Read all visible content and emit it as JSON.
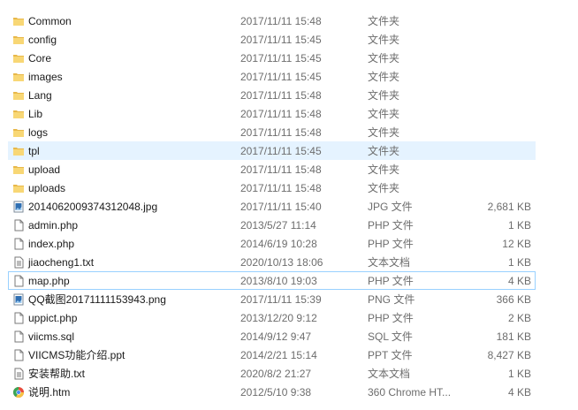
{
  "files": [
    {
      "name": "Common",
      "date": "2017/11/11 15:48",
      "type": "文件夹",
      "size": "",
      "icon": "folder-icon",
      "state": ""
    },
    {
      "name": "config",
      "date": "2017/11/11 15:45",
      "type": "文件夹",
      "size": "",
      "icon": "folder-icon",
      "state": ""
    },
    {
      "name": "Core",
      "date": "2017/11/11 15:45",
      "type": "文件夹",
      "size": "",
      "icon": "folder-icon",
      "state": ""
    },
    {
      "name": "images",
      "date": "2017/11/11 15:45",
      "type": "文件夹",
      "size": "",
      "icon": "folder-icon",
      "state": ""
    },
    {
      "name": "Lang",
      "date": "2017/11/11 15:48",
      "type": "文件夹",
      "size": "",
      "icon": "folder-icon",
      "state": ""
    },
    {
      "name": "Lib",
      "date": "2017/11/11 15:48",
      "type": "文件夹",
      "size": "",
      "icon": "folder-icon",
      "state": ""
    },
    {
      "name": "logs",
      "date": "2017/11/11 15:48",
      "type": "文件夹",
      "size": "",
      "icon": "folder-icon",
      "state": ""
    },
    {
      "name": "tpl",
      "date": "2017/11/11 15:45",
      "type": "文件夹",
      "size": "",
      "icon": "folder-icon",
      "state": "hover"
    },
    {
      "name": "upload",
      "date": "2017/11/11 15:48",
      "type": "文件夹",
      "size": "",
      "icon": "folder-icon",
      "state": ""
    },
    {
      "name": "uploads",
      "date": "2017/11/11 15:48",
      "type": "文件夹",
      "size": "",
      "icon": "folder-icon",
      "state": ""
    },
    {
      "name": "20140620093743120​48.jpg",
      "date": "2017/11/11 15:40",
      "type": "JPG 文件",
      "size": "2,681 KB",
      "icon": "image-file-icon",
      "state": ""
    },
    {
      "name": "admin.php",
      "date": "2013/5/27 11:14",
      "type": "PHP 文件",
      "size": "1 KB",
      "icon": "blank-file-icon",
      "state": ""
    },
    {
      "name": "index.php",
      "date": "2014/6/19 10:28",
      "type": "PHP 文件",
      "size": "12 KB",
      "icon": "blank-file-icon",
      "state": ""
    },
    {
      "name": "jiaocheng1.txt",
      "date": "2020/10/13 18:06",
      "type": "文本文档",
      "size": "1 KB",
      "icon": "text-file-icon",
      "state": ""
    },
    {
      "name": "map.php",
      "date": "2013/8/10 19:03",
      "type": "PHP 文件",
      "size": "4 KB",
      "icon": "blank-file-icon",
      "state": "focused"
    },
    {
      "name": "QQ截图20171111153943.png",
      "date": "2017/11/11 15:39",
      "type": "PNG 文件",
      "size": "366 KB",
      "icon": "image-file-icon",
      "state": ""
    },
    {
      "name": "uppict.php",
      "date": "2013/12/20 9:12",
      "type": "PHP 文件",
      "size": "2 KB",
      "icon": "blank-file-icon",
      "state": ""
    },
    {
      "name": "viicms.sql",
      "date": "2014/9/12 9:47",
      "type": "SQL 文件",
      "size": "181 KB",
      "icon": "blank-file-icon",
      "state": ""
    },
    {
      "name": "VIICMS功能介绍.ppt",
      "date": "2014/2/21 15:14",
      "type": "PPT 文件",
      "size": "8,427 KB",
      "icon": "blank-file-icon",
      "state": ""
    },
    {
      "name": "安装帮助.txt",
      "date": "2020/8/2 21:27",
      "type": "文本文档",
      "size": "1 KB",
      "icon": "text-file-icon",
      "state": ""
    },
    {
      "name": "说明.htm",
      "date": "2012/5/10 9:38",
      "type": "360 Chrome HT...",
      "size": "4 KB",
      "icon": "chrome-html-icon",
      "state": ""
    }
  ]
}
